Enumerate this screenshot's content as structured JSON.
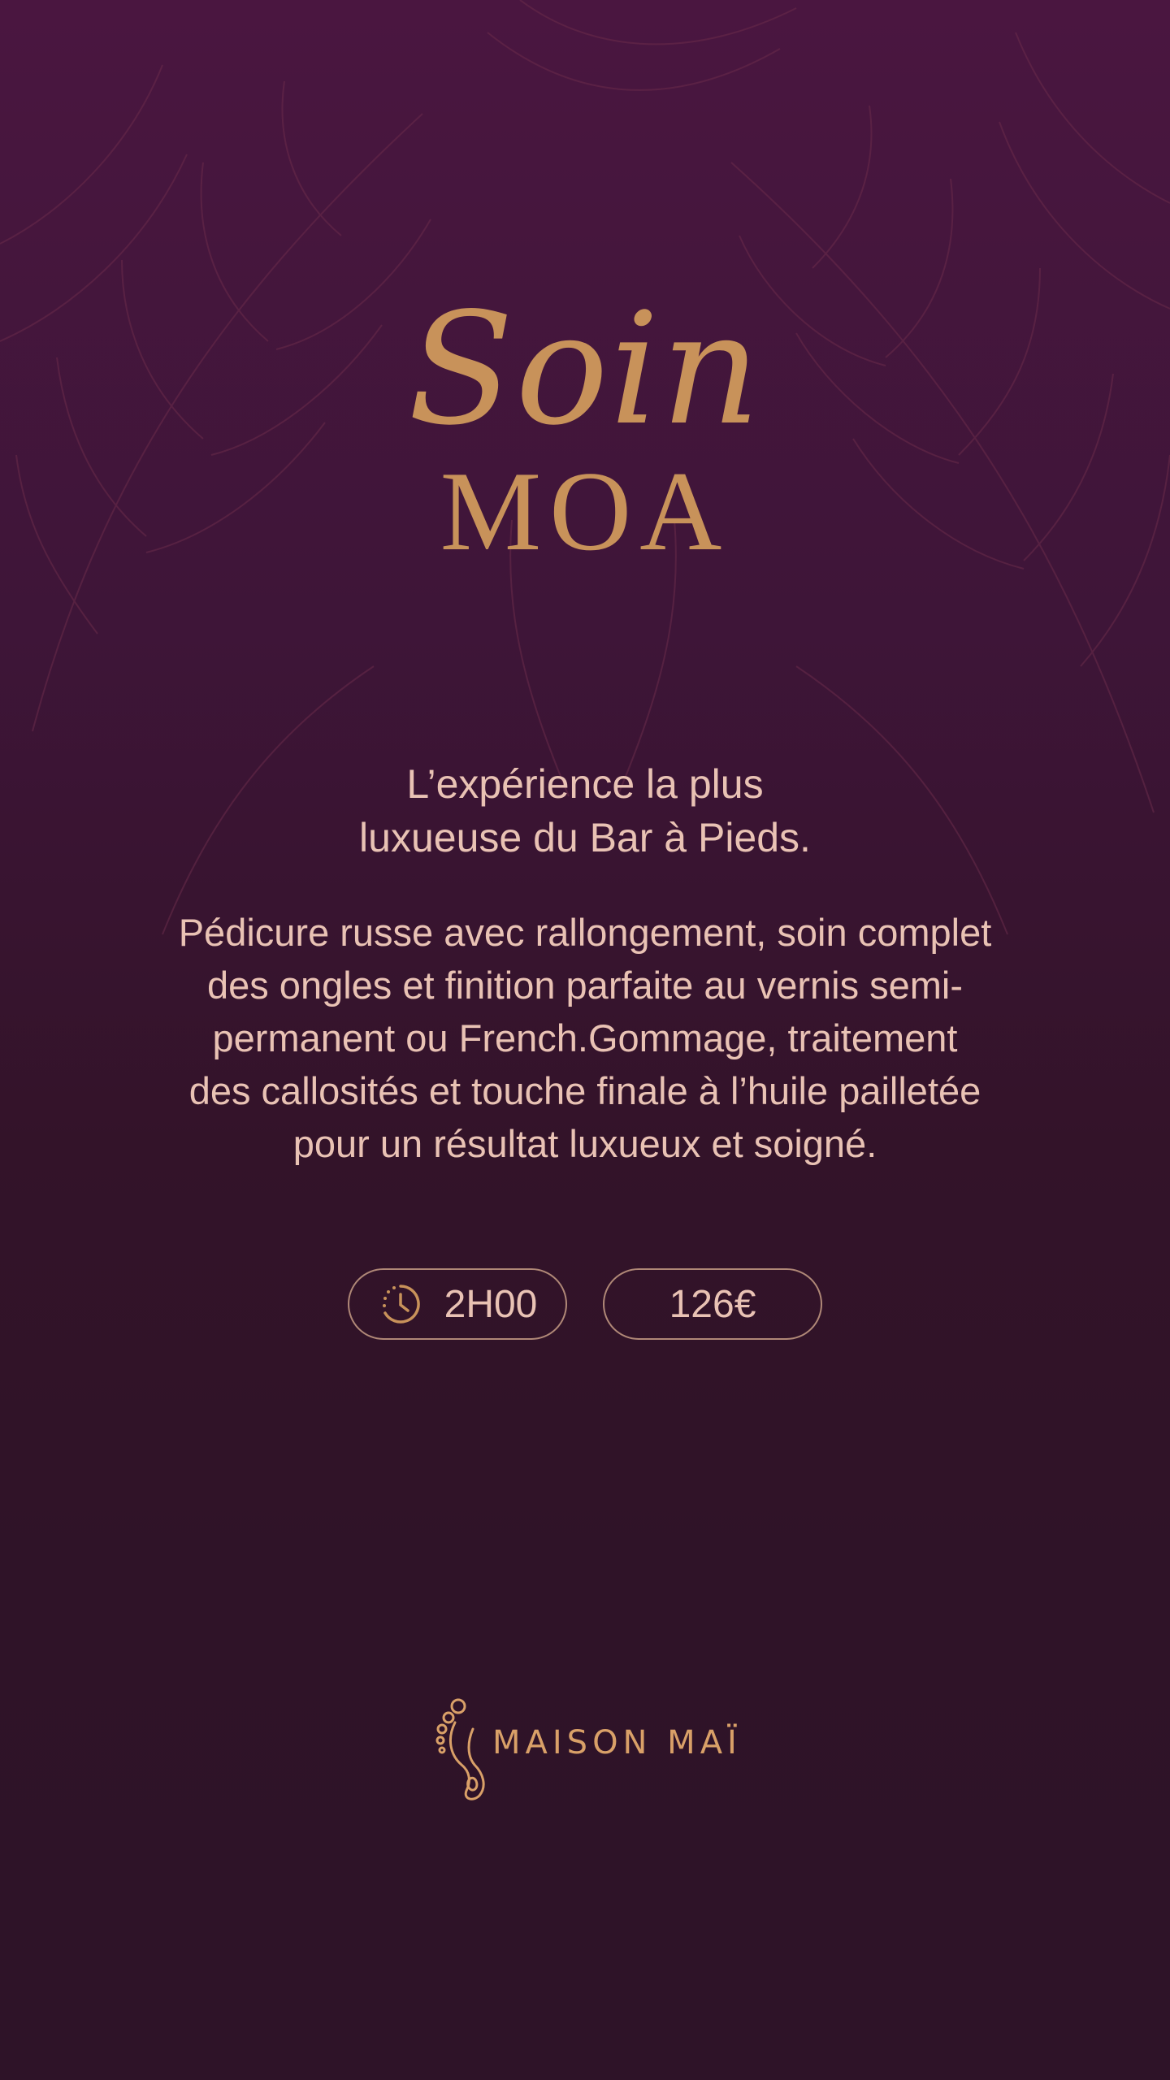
{
  "title": {
    "script": "Soin",
    "caps": "MOA"
  },
  "tagline": {
    "line1": "L’expérience la plus",
    "line2": "luxueuse du Bar à Pieds."
  },
  "description": {
    "lines": [
      "Pédicure russe avec rallongement, soin complet",
      "des ongles et finition parfaite au vernis semi-",
      "permanent ou French.Gommage, traitement",
      "des callosités et touche finale à l’huile pailletée",
      "pour un résultat luxueux et soigné."
    ]
  },
  "duration": {
    "icon": "clock-history-icon",
    "label": "2H00"
  },
  "price": {
    "label": "126€"
  },
  "brand": {
    "icon": "foot-icon",
    "name": "MAISON MAÏ"
  },
  "colors": {
    "background_top": "#4a1640",
    "background_bottom": "#2e1328",
    "gold": "#c8925a",
    "text": "#e9c2b4",
    "pill_border": "#b08877"
  }
}
